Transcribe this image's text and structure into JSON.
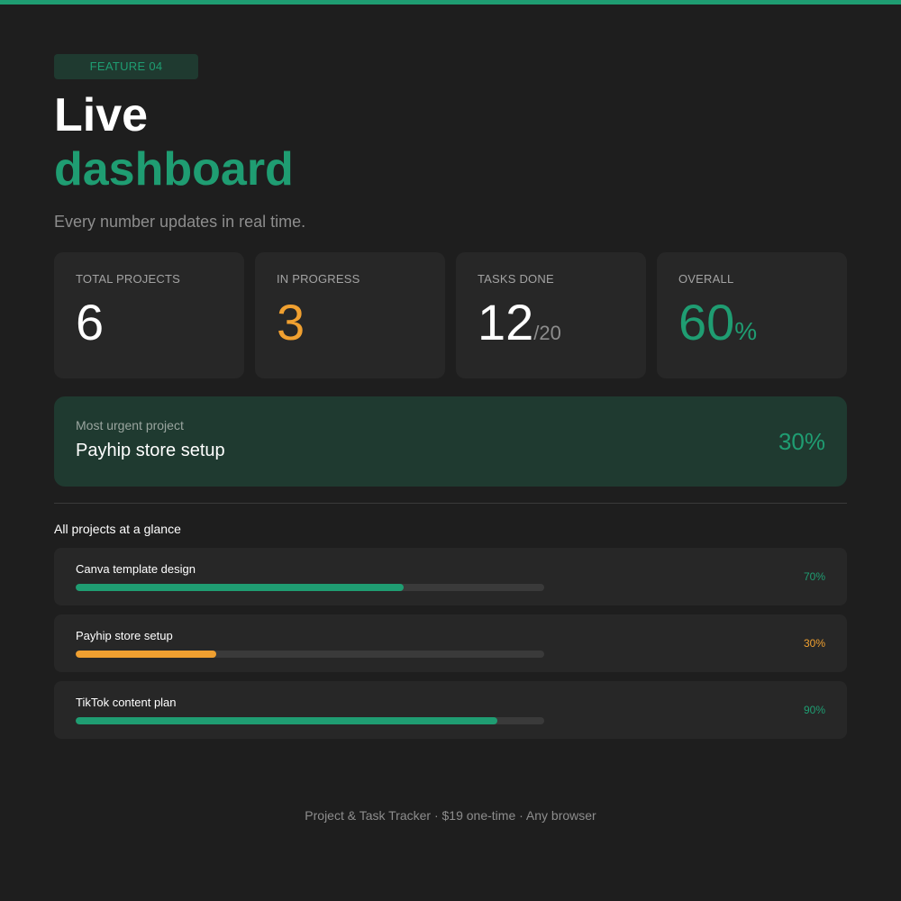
{
  "colors": {
    "accent": "#1f9d72",
    "warning": "#f0a030",
    "background": "#1e1e1e",
    "card": "#272727"
  },
  "badge": "FEATURE 04",
  "title": {
    "line1": "Live",
    "line2": "dashboard"
  },
  "subtitle": "Every number updates in real time.",
  "stats": [
    {
      "label": "TOTAL PROJECTS",
      "value": "6",
      "suffix": ""
    },
    {
      "label": "IN PROGRESS",
      "value": "3",
      "suffix": ""
    },
    {
      "label": "TASKS DONE",
      "value": "12",
      "suffix": "/20"
    },
    {
      "label": "OVERALL",
      "value": "60",
      "suffix": "%"
    }
  ],
  "urgent": {
    "label": "Most urgent project",
    "name": "Payhip store setup",
    "percent": "30%"
  },
  "projects_section_title": "All projects at a glance",
  "projects": [
    {
      "name": "Canva template design",
      "percent_label": "70%",
      "progress": 0.7,
      "status_color": "#1f9d72"
    },
    {
      "name": "Payhip store setup",
      "percent_label": "30%",
      "progress": 0.3,
      "status_color": "#f0a030"
    },
    {
      "name": "TikTok content plan",
      "percent_label": "90%",
      "progress": 0.9,
      "status_color": "#1f9d72"
    }
  ],
  "footer": "Project & Task Tracker · $19 one-time · Any browser"
}
